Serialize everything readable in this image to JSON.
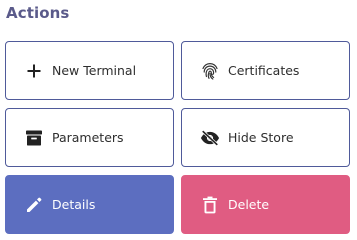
{
  "section": {
    "title": "Actions"
  },
  "buttons": {
    "new_terminal": {
      "label": "New Terminal",
      "icon": "plus-icon"
    },
    "certificates": {
      "label": "Certificates",
      "icon": "fingerprint-icon"
    },
    "parameters": {
      "label": "Parameters",
      "icon": "archive-icon"
    },
    "hide_store": {
      "label": "Hide Store",
      "icon": "eye-off-icon"
    },
    "details": {
      "label": "Details",
      "icon": "pencil-icon",
      "color": "#5c6ec0"
    },
    "delete": {
      "label": "Delete",
      "icon": "trash-icon",
      "color": "#e05c82"
    }
  },
  "colors": {
    "title": "#5a5a8a",
    "border": "#4f5a9a"
  }
}
